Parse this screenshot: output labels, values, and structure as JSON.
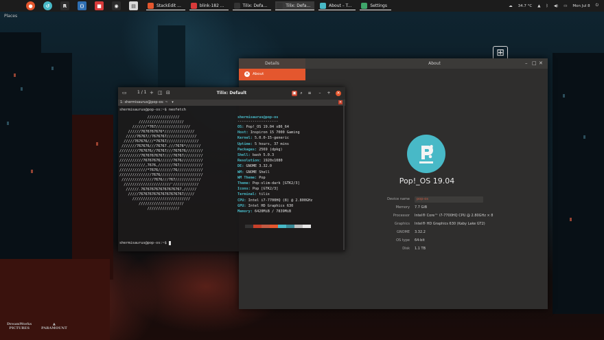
{
  "topbar": {
    "places": "Places",
    "tasks": [
      {
        "label": "StackEdit ...",
        "color": "#e4572e"
      },
      {
        "label": "blink-182 ...",
        "color": "#d83a3a"
      },
      {
        "label": "Tilix: Defa...",
        "color": "#333333"
      },
      {
        "label": "Tilix: Defa...",
        "color": "#333333",
        "active": true
      },
      {
        "label": "About – T...",
        "color": "#48b9c7"
      },
      {
        "label": "Settings",
        "color": "#3fa66a"
      }
    ],
    "temperature": "34.7 °C",
    "clock": "Mon Jul 8"
  },
  "about": {
    "tab": "Details",
    "title": "About",
    "selected": "About",
    "os_name": "Pop!_OS 19.04",
    "specs": [
      {
        "key": "Device name",
        "value": "pop-os",
        "editable": true
      },
      {
        "key": "Memory",
        "value": "7.7 GiB"
      },
      {
        "key": "Processor",
        "value": "Intel® Core™ i7-7700HQ CPU @ 2.80GHz × 8"
      },
      {
        "key": "Graphics",
        "value": "Intel® HD Graphics 630 (Kaby Lake GT2)"
      },
      {
        "key": "GNOME",
        "value": "3.32.2"
      },
      {
        "key": "OS type",
        "value": "64-bit"
      },
      {
        "key": "Disk",
        "value": "1.1 TB"
      }
    ]
  },
  "terminal": {
    "title": "Tilix: Default",
    "session_counter": "1 / 1",
    "subtab": "1: shermisaurus@pop-os: ~",
    "prompt": "shermisaurus@pop-os:~$ neofetch",
    "prompt_end": "shermisaurus@pop-os:~$ ",
    "ascii": [
      "             ///////////////",
      "         /////////////////////",
      "      ///////*767////////////////",
      "    //////7676767676*//////////////",
      "   /////76767//7676767//////////////",
      "  /////767676///*76767///////////////",
      " ///////767676///76767.///7676*///////",
      "/////////767676//76767///767676////////",
      "//////////76767676767////76767/////////",
      "///////////76767676//////7676//////////",
      "////////////,7676,///////767///////////",
      "/////////////*7676///////76////////////",
      "///////////////7676////////////////////",
      " ///////////////7676///767////////////",
      "  //////////////////////'////////////",
      "   //////.7676767676767676767,//////",
      "    /////767676767676767676767/////",
      "      ///////////////////////////",
      "         /////////////////////",
      "             ///////////////"
    ],
    "info_title": "shermisaurus@pop-os",
    "info_sep": "-------------------",
    "info": [
      {
        "key": "OS",
        "value": "Pop!_OS 19.04 x86_64"
      },
      {
        "key": "Host",
        "value": "Inspiron 15 7000 Gaming"
      },
      {
        "key": "Kernel",
        "value": "5.0.0-15-generic"
      },
      {
        "key": "Uptime",
        "value": "5 hours, 37 mins"
      },
      {
        "key": "Packages",
        "value": "2569 (dpkg)"
      },
      {
        "key": "Shell",
        "value": "bash 5.0.3"
      },
      {
        "key": "Resolution",
        "value": "1920x1080"
      },
      {
        "key": "DE",
        "value": "GNOME 3.32.0"
      },
      {
        "key": "WM",
        "value": "GNOME Shell"
      },
      {
        "key": "WM Theme",
        "value": "Pop"
      },
      {
        "key": "Theme",
        "value": "Pop-slim-dark [GTK2/3]"
      },
      {
        "key": "Icons",
        "value": "Pop [GTK2/3]"
      },
      {
        "key": "Terminal",
        "value": "tilix"
      },
      {
        "key": "CPU",
        "value": "Intel i7-7700HQ (8) @ 2.800GHz"
      },
      {
        "key": "GPU",
        "value": "Intel HD Graphics 630"
      },
      {
        "key": "Memory",
        "value": "6420MiB / 7839MiB"
      }
    ],
    "swatches": [
      "#333333",
      "#c7402a",
      "#c25a43",
      "#e4572e",
      "#48b9c7",
      "#3b8c99",
      "#c0c0c0",
      "#e8e8e8"
    ]
  },
  "colors": {
    "accent": "#e4572e",
    "pop_teal": "#48b9c7"
  }
}
